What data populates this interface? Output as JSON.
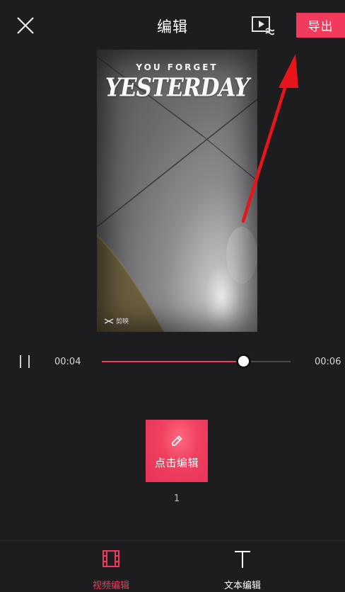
{
  "header": {
    "title": "编辑",
    "export_label": "导出"
  },
  "preview": {
    "overlay_line1": "YOU FORGET",
    "overlay_line2": "YESTERDAY",
    "watermark": "剪映"
  },
  "playback": {
    "current_time": "00:04",
    "total_time": "00:06",
    "progress": 0.75
  },
  "clip": {
    "edit_label": "点击编辑",
    "index": "1"
  },
  "bottom_nav": {
    "items": [
      {
        "label": "视频编辑",
        "icon": "film-icon",
        "active": true
      },
      {
        "label": "文本编辑",
        "icon": "text-icon",
        "active": false
      }
    ]
  },
  "colors": {
    "accent": "#f23b5c",
    "background": "#1d1d1f",
    "annotation_arrow": "#e8141c"
  }
}
